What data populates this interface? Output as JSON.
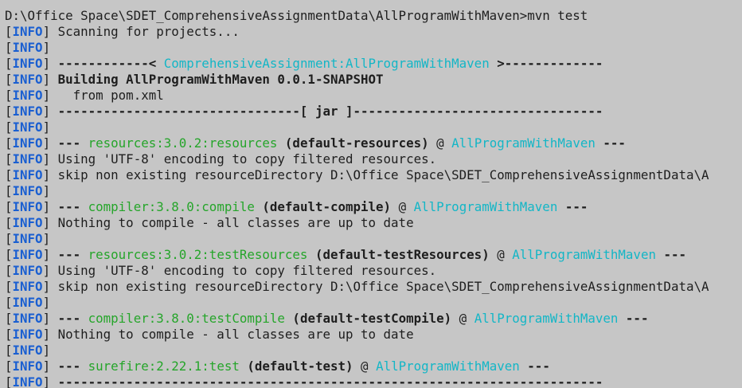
{
  "colors": {
    "background": "#c6c6c6",
    "text": "#1e1e1e",
    "info": "#1a5fd1",
    "cyan": "#13b6c6",
    "green": "#25a52a"
  },
  "prompt": {
    "text": "D:\\Office Space\\SDET_ComprehensiveAssignmentData\\AllProgramWithMaven>mvn test"
  },
  "info_label": "INFO",
  "lines": [
    {
      "segments": [
        {
          "text": " Scanning for projects...",
          "style": "plain"
        }
      ]
    },
    {
      "segments": []
    },
    {
      "segments": [
        {
          "text": " ------------< ",
          "style": "bold"
        },
        {
          "text": "ComprehensiveAssignment:AllProgramWithMaven",
          "style": "cyan"
        },
        {
          "text": " >-------------",
          "style": "bold"
        }
      ]
    },
    {
      "segments": [
        {
          "text": " Building AllProgramWithMaven 0.0.1-SNAPSHOT",
          "style": "bold"
        }
      ]
    },
    {
      "segments": [
        {
          "text": "   from pom.xml",
          "style": "plain"
        }
      ]
    },
    {
      "segments": [
        {
          "text": " --------------------------------[ jar ]---------------------------------",
          "style": "bold"
        }
      ]
    },
    {
      "segments": []
    },
    {
      "segments": [
        {
          "text": " --- ",
          "style": "bold"
        },
        {
          "text": "resources:3.0.2:resources",
          "style": "green"
        },
        {
          "text": " (default-resources)",
          "style": "bold"
        },
        {
          "text": " @ ",
          "style": "plain"
        },
        {
          "text": "AllProgramWithMaven",
          "style": "cyan"
        },
        {
          "text": " ---",
          "style": "bold"
        }
      ]
    },
    {
      "segments": [
        {
          "text": " Using 'UTF-8' encoding to copy filtered resources.",
          "style": "plain"
        }
      ]
    },
    {
      "segments": [
        {
          "text": " skip non existing resourceDirectory D:\\Office Space\\SDET_ComprehensiveAssignmentData\\A",
          "style": "plain"
        }
      ]
    },
    {
      "segments": []
    },
    {
      "segments": [
        {
          "text": " --- ",
          "style": "bold"
        },
        {
          "text": "compiler:3.8.0:compile",
          "style": "green"
        },
        {
          "text": " (default-compile)",
          "style": "bold"
        },
        {
          "text": " @ ",
          "style": "plain"
        },
        {
          "text": "AllProgramWithMaven",
          "style": "cyan"
        },
        {
          "text": " ---",
          "style": "bold"
        }
      ]
    },
    {
      "segments": [
        {
          "text": " Nothing to compile - all classes are up to date",
          "style": "plain"
        }
      ]
    },
    {
      "segments": []
    },
    {
      "segments": [
        {
          "text": " --- ",
          "style": "bold"
        },
        {
          "text": "resources:3.0.2:testResources",
          "style": "green"
        },
        {
          "text": " (default-testResources)",
          "style": "bold"
        },
        {
          "text": " @ ",
          "style": "plain"
        },
        {
          "text": "AllProgramWithMaven",
          "style": "cyan"
        },
        {
          "text": " ---",
          "style": "bold"
        }
      ]
    },
    {
      "segments": [
        {
          "text": " Using 'UTF-8' encoding to copy filtered resources.",
          "style": "plain"
        }
      ]
    },
    {
      "segments": [
        {
          "text": " skip non existing resourceDirectory D:\\Office Space\\SDET_ComprehensiveAssignmentData\\A",
          "style": "plain"
        }
      ]
    },
    {
      "segments": []
    },
    {
      "segments": [
        {
          "text": " --- ",
          "style": "bold"
        },
        {
          "text": "compiler:3.8.0:testCompile",
          "style": "green"
        },
        {
          "text": " (default-testCompile)",
          "style": "bold"
        },
        {
          "text": " @ ",
          "style": "plain"
        },
        {
          "text": "AllProgramWithMaven",
          "style": "cyan"
        },
        {
          "text": " ---",
          "style": "bold"
        }
      ]
    },
    {
      "segments": [
        {
          "text": " Nothing to compile - all classes are up to date",
          "style": "plain"
        }
      ]
    },
    {
      "segments": []
    },
    {
      "segments": [
        {
          "text": " --- ",
          "style": "bold"
        },
        {
          "text": "surefire:2.22.1:test",
          "style": "green"
        },
        {
          "text": " (default-test)",
          "style": "bold"
        },
        {
          "text": " @ ",
          "style": "plain"
        },
        {
          "text": "AllProgramWithMaven",
          "style": "cyan"
        },
        {
          "text": " ---",
          "style": "bold"
        }
      ]
    },
    {
      "segments": [
        {
          "text": " ------------------------------------------------------------------------",
          "style": "bold"
        }
      ]
    }
  ]
}
